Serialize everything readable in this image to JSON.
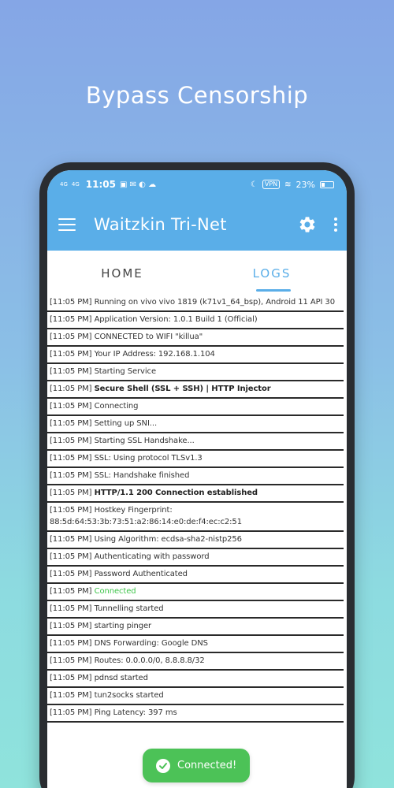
{
  "headline": "Bypass Censorship",
  "status_bar": {
    "time": "11:05",
    "signal_1": "4G",
    "signal_2": "4G",
    "vpn": "VPN",
    "battery": "23%"
  },
  "app_bar": {
    "title": "Waitzkin Tri-Net",
    "menu_icon": "hamburger-icon",
    "settings_icon": "gear-icon",
    "overflow_icon": "more-vert-icon"
  },
  "tabs": [
    {
      "label": "HOME",
      "active": false
    },
    {
      "label": "LOGS",
      "active": true
    }
  ],
  "logs": [
    {
      "time": "[11:05 PM]",
      "msg": "Running on vivo vivo 1819 (k71v1_64_bsp), Android 11 API 30"
    },
    {
      "time": "[11:05 PM]",
      "msg": "Application Version: 1.0.1 Build 1 (Official)"
    },
    {
      "time": "[11:05 PM]",
      "msg": "CONNECTED to WIFI \"killua\""
    },
    {
      "time": "[11:05 PM]",
      "msg": "Your IP Address: 192.168.1.104"
    },
    {
      "time": "[11:05 PM]",
      "msg": "Starting Service"
    },
    {
      "time": "[11:05 PM]",
      "msg": "Secure Shell (SSL + SSH) | HTTP Injector"
    },
    {
      "time": "[11:05 PM]",
      "msg": "Connecting"
    },
    {
      "time": "[11:05 PM]",
      "msg": "Setting up SNI..."
    },
    {
      "time": "[11:05 PM]",
      "msg": "Starting SSL Handshake..."
    },
    {
      "time": "[11:05 PM]",
      "msg": "SSL: Using protocol TLSv1.3"
    },
    {
      "time": "[11:05 PM]",
      "msg": "SSL: Handshake finished"
    },
    {
      "time": "[11:05 PM]",
      "msg": "HTTP/1.1 200 Connection established"
    },
    {
      "time": "[11:05 PM]",
      "msg": "Hostkey Fingerprint: 88:5d:64:53:3b:73:51:a2:86:14:e0:de:f4:ec:c2:51"
    },
    {
      "time": "[11:05 PM]",
      "msg": "Using Algorithm: ecdsa-sha2-nistp256"
    },
    {
      "time": "[11:05 PM]",
      "msg": "Authenticating with password"
    },
    {
      "time": "[11:05 PM]",
      "msg": "Password Authenticated"
    },
    {
      "time": "[11:05 PM]",
      "msg": "Connected"
    },
    {
      "time": "[11:05 PM]",
      "msg": "Tunnelling started"
    },
    {
      "time": "[11:05 PM]",
      "msg": "starting pinger"
    },
    {
      "time": "[11:05 PM]",
      "msg": "DNS Forwarding: Google DNS"
    },
    {
      "time": "[11:05 PM]",
      "msg": "Routes: 0.0.0.0/0, 8.8.8.8/32"
    },
    {
      "time": "[11:05 PM]",
      "msg": "pdnsd started"
    },
    {
      "time": "[11:05 PM]",
      "msg": "tun2socks started"
    },
    {
      "time": "[11:05 PM]",
      "msg": "Ping Latency: 397 ms"
    }
  ],
  "toast": {
    "label": "Connected!",
    "icon": "check-circle-icon"
  },
  "colors": {
    "primary": "#5aaee8",
    "success": "#4cc257",
    "connected_text": "#3ec44a"
  }
}
